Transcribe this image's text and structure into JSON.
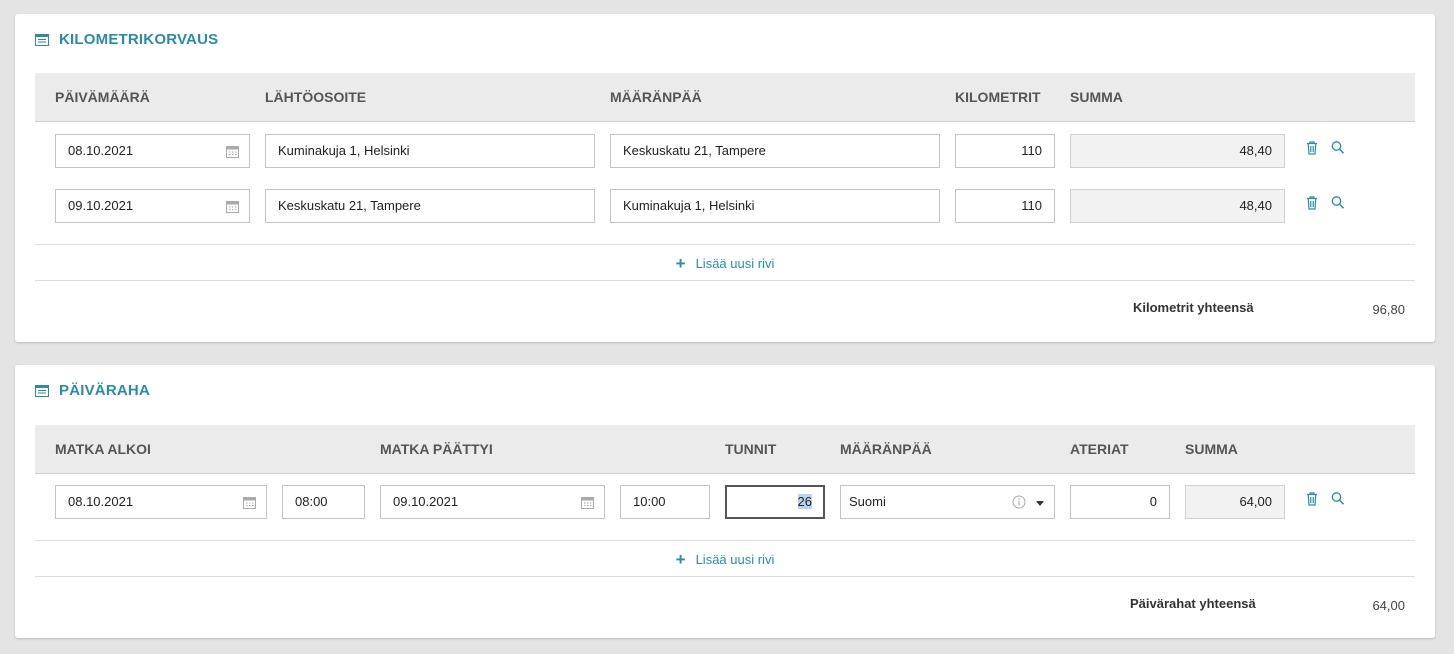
{
  "km": {
    "title": "KILOMETRIKORVAUS",
    "headers": {
      "date": "PÄIVÄMÄÄRÄ",
      "origin": "LÄHTÖOSOITE",
      "destination": "MÄÄRÄNPÄÄ",
      "kilometers": "KILOMETRIT",
      "sum": "SUMMA"
    },
    "rows": [
      {
        "date": "08.10.2021",
        "origin": "Kuminakuja 1, Helsinki",
        "destination": "Keskuskatu 21, Tampere",
        "kilometers": "110",
        "sum": "48,40"
      },
      {
        "date": "09.10.2021",
        "origin": "Keskuskatu 21, Tampere",
        "destination": "Kuminakuja 1, Helsinki",
        "kilometers": "110",
        "sum": "48,40"
      }
    ],
    "add_row_label": "Lisää uusi rivi",
    "total_label": "Kilometrit yhteensä",
    "total_value": "96,80"
  },
  "per_diem": {
    "title": "PÄIVÄRAHA",
    "headers": {
      "start": "MATKA ALKOI",
      "end": "MATKA PÄÄTTYI",
      "hours": "TUNNIT",
      "destination": "MÄÄRÄNPÄÄ",
      "meals": "ATERIAT",
      "sum": "SUMMA"
    },
    "rows": [
      {
        "start_date": "08.10.2021",
        "start_time": "08:00",
        "end_date": "09.10.2021",
        "end_time": "10:00",
        "hours": "26",
        "destination": "Suomi",
        "meals": "0",
        "sum": "64,00"
      }
    ],
    "add_row_label": "Lisää uusi rivi",
    "total_label": "Päivärahat yhteensä",
    "total_value": "64,00"
  },
  "icons": {
    "section": "list-icon",
    "date_picker": "calendar-icon",
    "delete": "trash-icon",
    "view": "search-icon",
    "add": "plus-icon",
    "info": "info-icon",
    "dropdown": "caret-down-icon"
  },
  "colors": {
    "accent": "#2a8ea3",
    "background": "#e4e4e4",
    "header_bg": "#ebebeb"
  }
}
